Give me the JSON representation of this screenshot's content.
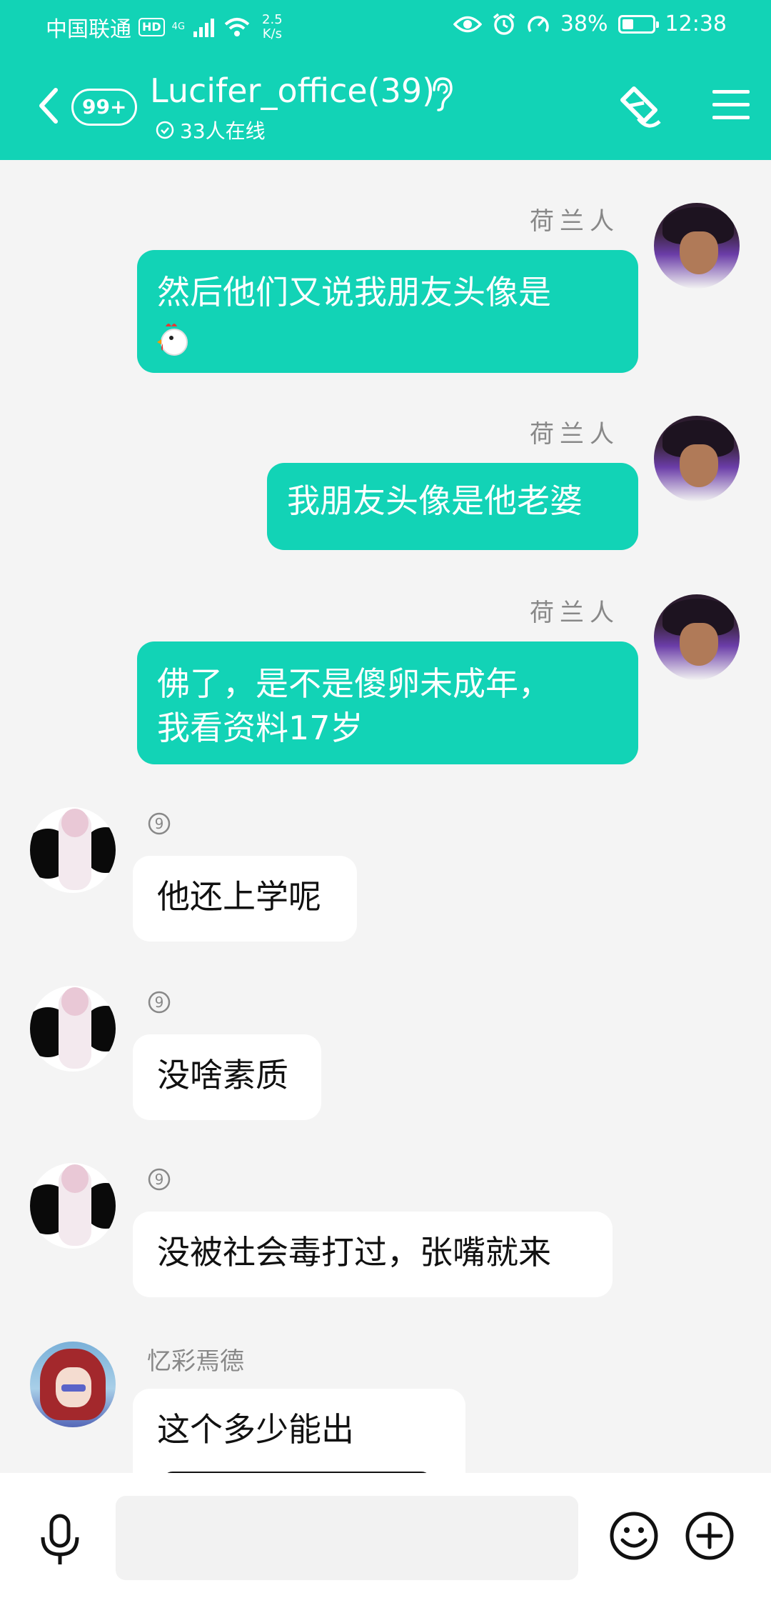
{
  "status_bar": {
    "carrier": "中国联通",
    "hd": "HD",
    "network": "4G",
    "speed_value": "2.5",
    "speed_unit": "K/s",
    "battery": "38%",
    "battery_level": 0.38,
    "time": "12:38"
  },
  "header": {
    "unread": "99+",
    "title": "Lucifer_office(39)",
    "online": "33人在线"
  },
  "messages": [
    {
      "side": "out",
      "sender": "荷兰人",
      "text": "然后他们又说我朋友头像是",
      "emoji": "chicken"
    },
    {
      "side": "out",
      "sender": "荷兰人",
      "text": "我朋友头像是他老婆"
    },
    {
      "side": "out",
      "sender": "荷兰人",
      "line1": "佛了，是不是傻卵未成年，",
      "line2": "我看资料17岁"
    },
    {
      "side": "in",
      "sender_icon": "circled-nine",
      "text": "他还上学呢"
    },
    {
      "side": "in",
      "sender_icon": "circled-nine",
      "text": "没啥素质"
    },
    {
      "side": "in",
      "sender_icon": "circled-nine",
      "text": "没被社会毒打过，张嘴就来"
    },
    {
      "side": "in",
      "sender": "忆彩焉德",
      "text": "这个多少能出"
    }
  ],
  "input": {
    "value": "",
    "placeholder": ""
  },
  "colors": {
    "accent": "#12d3b6",
    "background": "#f4f4f4",
    "bubble_in": "#ffffff"
  },
  "icons": [
    "back-icon",
    "ear-icon",
    "check-circle-icon",
    "share-icon",
    "menu-icon",
    "microphone-icon",
    "emoji-icon",
    "plus-icon",
    "circled-nine-icon"
  ]
}
